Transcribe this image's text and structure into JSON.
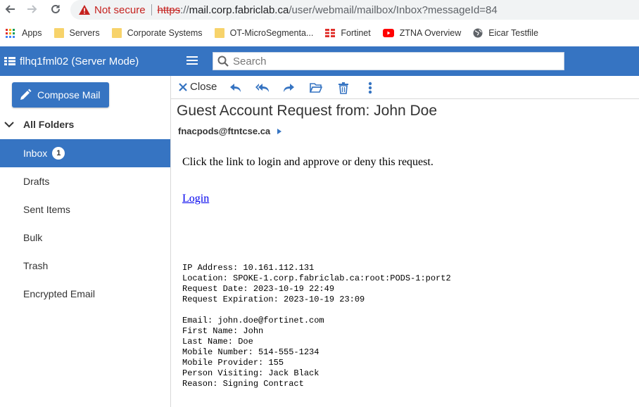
{
  "browser": {
    "not_secure": "Not secure",
    "url_protocol": "https",
    "url_host": "mail.corp.fabriclab.ca",
    "url_path": "/user/webmail/mailbox/Inbox?messageId=84",
    "bookmarks": [
      {
        "label": "Apps",
        "icon": "apps-grid-icon"
      },
      {
        "label": "Servers",
        "icon": "folder-icon"
      },
      {
        "label": "Corporate Systems",
        "icon": "folder-icon"
      },
      {
        "label": "OT-MicroSegmenta...",
        "icon": "folder-icon"
      },
      {
        "label": "Fortinet",
        "icon": "fortinet-icon"
      },
      {
        "label": "ZTNA Overview",
        "icon": "youtube-icon"
      },
      {
        "label": "Eicar Testfile",
        "icon": "globe-icon"
      }
    ]
  },
  "header": {
    "server_title": "flhq1fml02 (Server Mode)",
    "search_placeholder": "Search"
  },
  "sidebar": {
    "compose_label": "Compose Mail",
    "all_folders_label": "All Folders",
    "folders": [
      {
        "label": "Inbox",
        "badge": "1"
      },
      {
        "label": "Drafts"
      },
      {
        "label": "Sent Items"
      },
      {
        "label": "Bulk"
      },
      {
        "label": "Trash"
      },
      {
        "label": "Encrypted Email"
      }
    ]
  },
  "toolbar": {
    "close_label": "Close"
  },
  "message": {
    "subject": "Guest Account Request from: John Doe",
    "from": "fnacpods@ftntcse.ca",
    "body_text": "Click the link to login and approve or deny this request.",
    "login_link": "Login",
    "details": "IP Address: 10.161.112.131\nLocation: SPOKE-1.corp.fabriclab.ca:root:PODS-1:port2\nRequest Date: 2023-10-19 22:49\nRequest Expiration: 2023-10-19 23:09\n\nEmail: john.doe@fortinet.com\nFirst Name: John\nLast Name: Doe\nMobile Number: 514-555-1234\nMobile Provider: 155\nPerson Visiting: Jack Black\nReason: Signing Contract"
  },
  "colors": {
    "brand_blue": "#3674c2",
    "warning_red": "#c5221f"
  }
}
